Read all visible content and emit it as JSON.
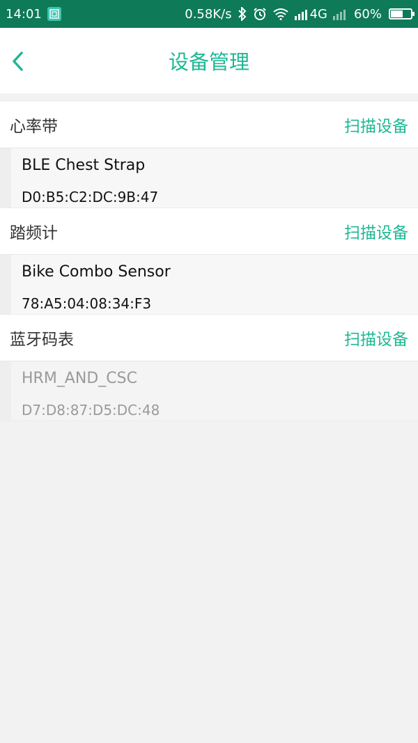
{
  "status_bar": {
    "time": "14:01",
    "network_speed": "0.58K/s",
    "network_type": "4G",
    "battery_percent": "60%",
    "battery_level": 0.6,
    "icons": [
      "screenshot-app-icon",
      "bluetooth-icon",
      "alarm-icon",
      "wifi-icon",
      "signal-icon",
      "signal-2-icon",
      "battery-icon"
    ]
  },
  "header": {
    "title": "设备管理",
    "back_icon": "chevron-left-icon"
  },
  "colors": {
    "accent": "#1db894",
    "status_bar": "#0e7a57",
    "inactive_text": "#9a9a9a"
  },
  "sections": [
    {
      "title": "心率带",
      "scan_label": "扫描设备",
      "device": {
        "name": "BLE Chest Strap",
        "mac": "D0:B5:C2:DC:9B:47",
        "active": true
      }
    },
    {
      "title": "踏频计",
      "scan_label": "扫描设备",
      "device": {
        "name": "Bike Combo Sensor",
        "mac": "78:A5:04:08:34:F3",
        "active": true
      }
    },
    {
      "title": "蓝牙码表",
      "scan_label": "扫描设备",
      "device": {
        "name": "HRM_AND_CSC",
        "mac": "D7:D8:87:D5:DC:48",
        "active": false
      }
    }
  ]
}
